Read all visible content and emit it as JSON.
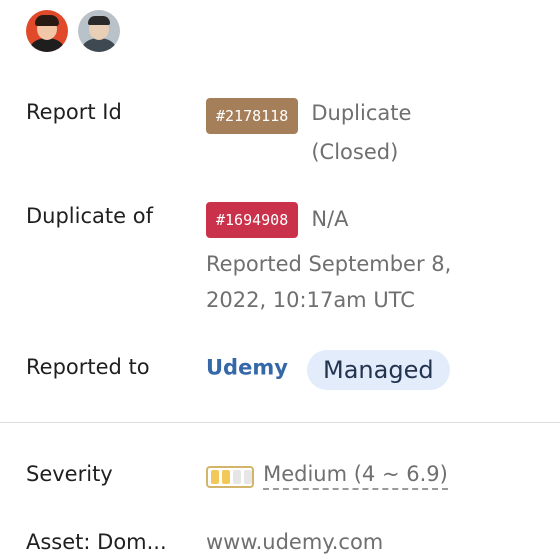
{
  "report": {
    "avatars": [
      {
        "name": "reporter-avatar-1"
      },
      {
        "name": "reporter-avatar-2"
      }
    ],
    "report_id": {
      "label": "Report Id",
      "badge": "#2178118",
      "status": "Duplicate",
      "status_detail": "(Closed)",
      "badge_color": "#a57e5a"
    },
    "duplicate_of": {
      "label": "Duplicate of",
      "badge": "#1694908",
      "status": "N/A",
      "reported_line1": "Reported September 8,",
      "reported_line2": "2022, 10:17am UTC",
      "badge_color": "#c9324a"
    },
    "reported_to": {
      "label": "Reported to",
      "org": "Udemy",
      "pill": "Managed"
    },
    "severity": {
      "label": "Severity",
      "value": "Medium (4 ~ 6.9)",
      "level_filled_segments": 2,
      "level_total_segments": 4
    },
    "asset": {
      "label": "Asset: Dom...",
      "value": "www.udemy.com"
    }
  }
}
